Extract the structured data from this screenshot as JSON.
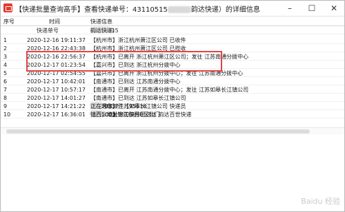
{
  "window": {
    "title_prefix": "【快递批量查询高手】查看快递单号：",
    "tracking_no": "43110515",
    "title_suffix": "韵达快递）的详细信息",
    "controls": {
      "min": "–",
      "max": "☐",
      "close": "✕"
    }
  },
  "grid": {
    "headers": {
      "seq": "序号",
      "time": "时间",
      "info": "快递信息"
    },
    "subheader": {
      "time": "快递单号",
      "info": "43110515",
      "info_suffix": "韵达快递）"
    },
    "rows": [
      {
        "seq": "1",
        "time": "2020-12-16 19:11:37",
        "info": "【杭州市】浙江杭州萧江区公司 已收件"
      },
      {
        "seq": "2",
        "time": "2020-12-16 22:43:38",
        "info": "【杭州市】浙江杭州萧江区公司 已揽收"
      },
      {
        "seq": "3",
        "time": "2020-12-16 22:56:37",
        "info": "【杭州市】已离开 浙江杭州萧江区公司；发往 江苏南通分拨中心"
      },
      {
        "seq": "4",
        "time": "2020-12-17 01:23:54",
        "info": "【嘉兴市】已到达 浙江杭州分拨中心"
      },
      {
        "seq": "5",
        "time": "2020-12-17 02:54:55",
        "info": "【嘉兴市】已离开 浙江杭州分拨中心；发往 江苏南通分拨中心"
      },
      {
        "seq": "6",
        "time": "2020-12-17 10:42:01",
        "info": "【南通市】已到达 江苏南通分拨中心"
      },
      {
        "seq": "7",
        "time": "2020-12-17 10:57:17",
        "info": "【南通市】已离开 江苏南通分拨中心；发往 江苏如皋长江镇公司"
      },
      {
        "seq": "8",
        "time": "2020-12-17 14:01:27",
        "info": "【南通市】已到达 江苏如皋长江镇公司"
      },
      {
        "seq": "9",
        "time": "2020-12-17 14:21:22",
        "info": "【南通市】江苏如皋长江镇公司 快递员",
        "info_tail": "19850337",
        "info_tail2": "正在为您派件【95114"
      },
      {
        "seq": "10",
        "time": "2020-12-17 16:36:01",
        "info": "【代收点】您的快件已送达 韵达百世快递",
        "info_tail": "保管，地址：",
        "info_tail2": "镇西500米锦江御园B区北门"
      }
    ]
  },
  "watermark": "Baidu 经验"
}
